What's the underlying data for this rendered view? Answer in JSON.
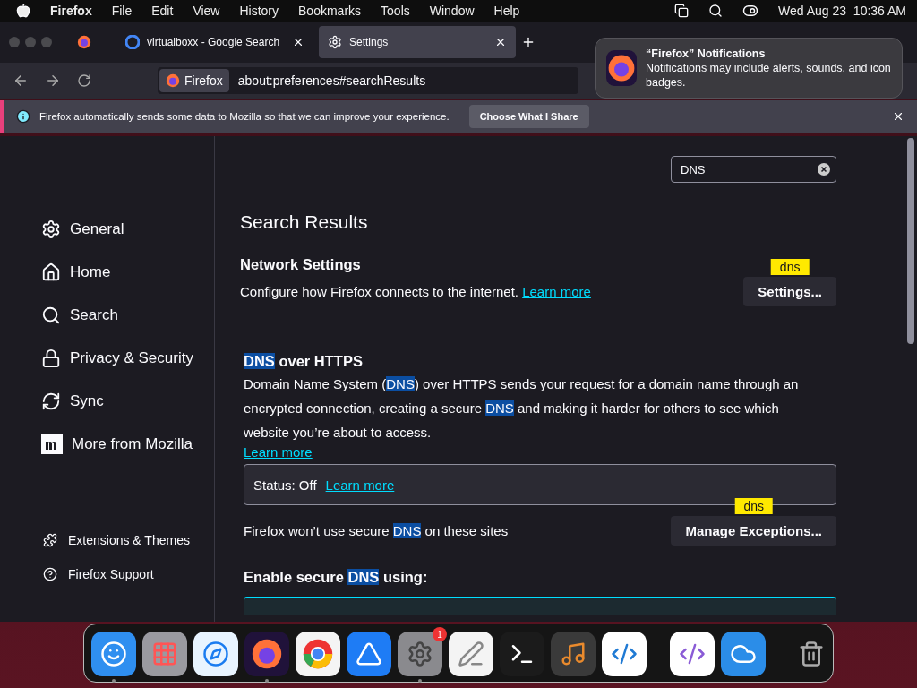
{
  "menu_bar": {
    "app": "Firefox",
    "items": [
      "File",
      "Edit",
      "View",
      "History",
      "Bookmarks",
      "Tools",
      "Window",
      "Help"
    ],
    "clock": "Wed Aug 23  10:36 AM"
  },
  "tabs": [
    {
      "kind": "google",
      "title": "virtualboxx - Google Search",
      "selected": false
    },
    {
      "kind": "settings",
      "title": "Settings",
      "selected": true
    }
  ],
  "address_bar": {
    "identity": "Firefox",
    "url": "about:preferences#searchResults"
  },
  "notification": {
    "title": "“Firefox” Notifications",
    "body": "Notifications may include alerts, sounds, and icon badges."
  },
  "info_bar": {
    "message": "Firefox automatically sends some data to Mozilla so that we can improve your experience.",
    "button": "Choose What I Share"
  },
  "sidebar": {
    "items": [
      {
        "kind": "general",
        "label": "General",
        "selected": false
      },
      {
        "kind": "home",
        "label": "Home",
        "selected": false
      },
      {
        "kind": "search",
        "label": "Search",
        "selected": false
      },
      {
        "kind": "privacy",
        "label": "Privacy & Security",
        "selected": false
      },
      {
        "kind": "sync",
        "label": "Sync",
        "selected": false
      },
      {
        "kind": "mozilla",
        "label": "More from Mozilla",
        "selected": false
      }
    ],
    "footer": [
      {
        "kind": "extensions",
        "label": "Extensions & Themes"
      },
      {
        "kind": "support",
        "label": "Firefox Support"
      }
    ]
  },
  "search": {
    "value": "DNS"
  },
  "heading": "Search Results",
  "network": {
    "title": "Network Settings",
    "text": "Configure how Firefox connects to the internet.",
    "link": "Learn more",
    "badge": "dns",
    "button": "Settings..."
  },
  "doh": {
    "title": [
      {
        "text": "DNS",
        "highlight": true
      },
      {
        "text": " over HTTPS",
        "highlight": false
      }
    ],
    "description": [
      {
        "text": "Domain Name System (",
        "highlight": false
      },
      {
        "text": "DNS",
        "highlight": true
      },
      {
        "text": ") over HTTPS sends your request for a domain name through an encrypted connection, creating a secure ",
        "highlight": false
      },
      {
        "text": "DNS",
        "highlight": true
      },
      {
        "text": " and making it harder for others to see which website you’re about to access.",
        "highlight": false
      }
    ],
    "link": "Learn more",
    "status": "Status: Off",
    "status_link": "Learn more",
    "exceptions_text": [
      {
        "text": "Firefox won’t use secure ",
        "highlight": false
      },
      {
        "text": "DNS",
        "highlight": true
      },
      {
        "text": " on these sites",
        "highlight": false
      }
    ],
    "badge": "dns",
    "exceptions_button": "Manage Exceptions...",
    "enable_title": [
      {
        "text": "Enable secure ",
        "highlight": false
      },
      {
        "text": "DNS",
        "highlight": true
      },
      {
        "text": " using:",
        "highlight": false
      }
    ]
  },
  "dock": [
    {
      "kind": "finder",
      "running": true
    },
    {
      "kind": "launchpad",
      "running": false
    },
    {
      "kind": "safari",
      "running": false
    },
    {
      "kind": "firefox",
      "running": true
    },
    {
      "kind": "chrome",
      "running": false
    },
    {
      "kind": "appstore",
      "running": false
    },
    {
      "kind": "settings",
      "running": true,
      "badge": "1"
    },
    {
      "kind": "textedit",
      "running": false
    },
    {
      "kind": "terminal",
      "running": false
    },
    {
      "kind": "garageband",
      "running": false
    },
    {
      "kind": "vscode",
      "running": false
    },
    {
      "kind": "divider"
    },
    {
      "kind": "visualstudio",
      "running": false
    },
    {
      "kind": "weather",
      "running": false
    },
    {
      "kind": "divider"
    },
    {
      "kind": "trash",
      "running": false
    }
  ]
}
